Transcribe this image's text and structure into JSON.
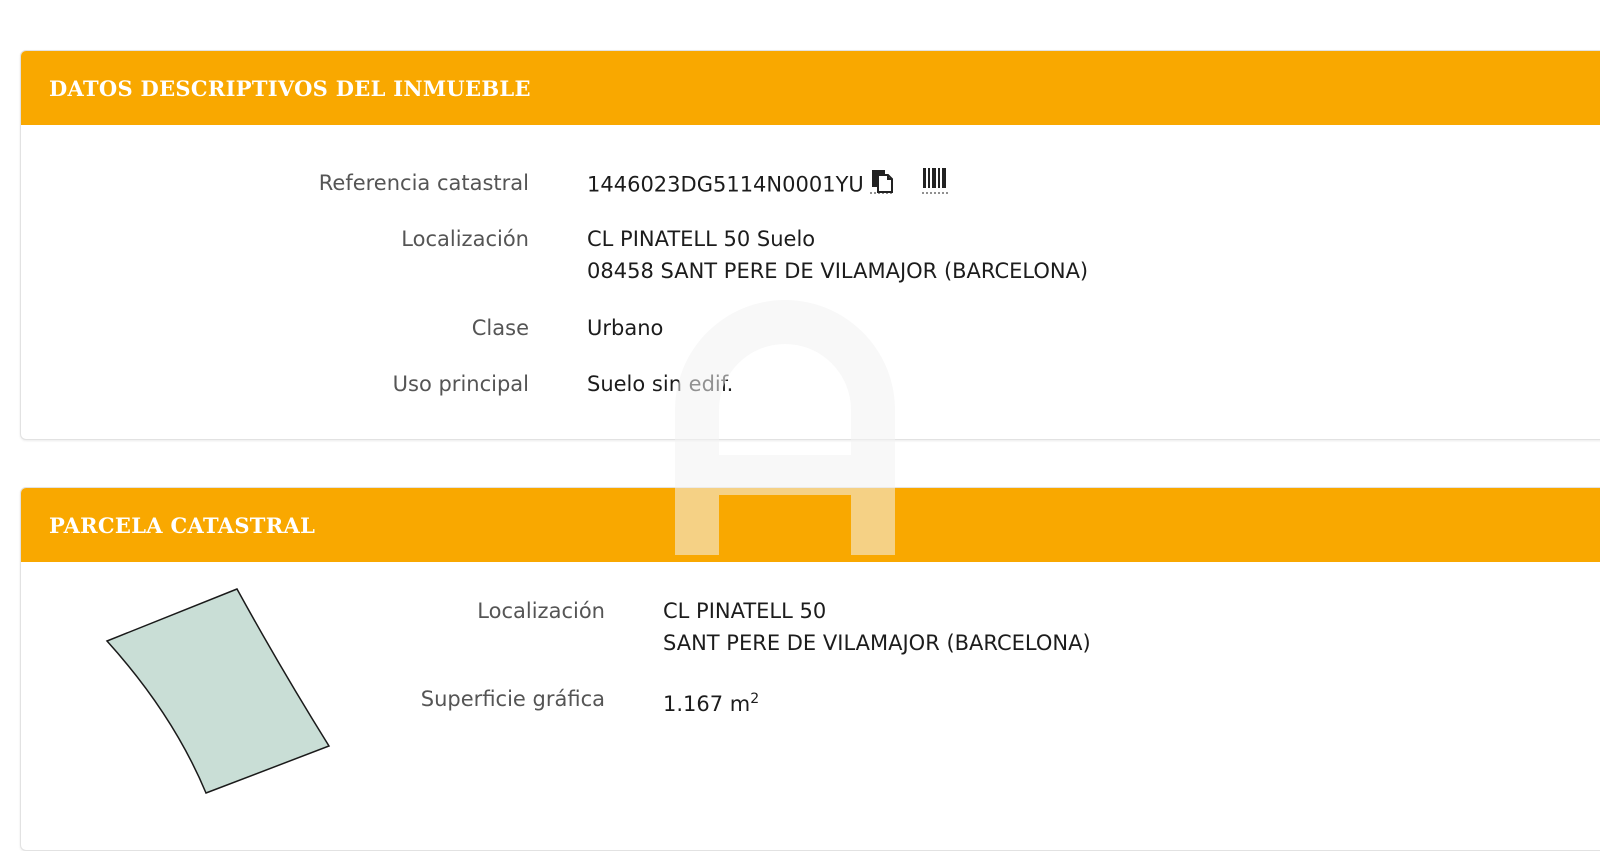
{
  "descriptivos": {
    "title": "DATOS DESCRIPTIVOS DEL INMUEBLE",
    "referencia": {
      "label": "Referencia catastral",
      "value": "1446023DG5114N0001YU"
    },
    "localizacion": {
      "label": "Localización",
      "line1": "CL PINATELL 50 Suelo",
      "line2": "08458 SANT PERE DE VILAMAJOR (BARCELONA)"
    },
    "clase": {
      "label": "Clase",
      "value": "Urbano"
    },
    "uso": {
      "label": "Uso principal",
      "value": "Suelo sin edif."
    }
  },
  "parcela": {
    "title": "PARCELA CATASTRAL",
    "localizacion": {
      "label": "Localización",
      "line1": "CL PINATELL 50",
      "line2": "SANT PERE DE VILAMAJOR (BARCELONA)"
    },
    "superficie": {
      "label": "Superficie gráfica",
      "value": "1.167 m",
      "unit_sup": "2"
    }
  },
  "icons": {
    "copy": "copy-icon",
    "barcode": "barcode-icon"
  },
  "colors": {
    "header": "#f9a800",
    "parcel_fill": "#c9ded6"
  }
}
